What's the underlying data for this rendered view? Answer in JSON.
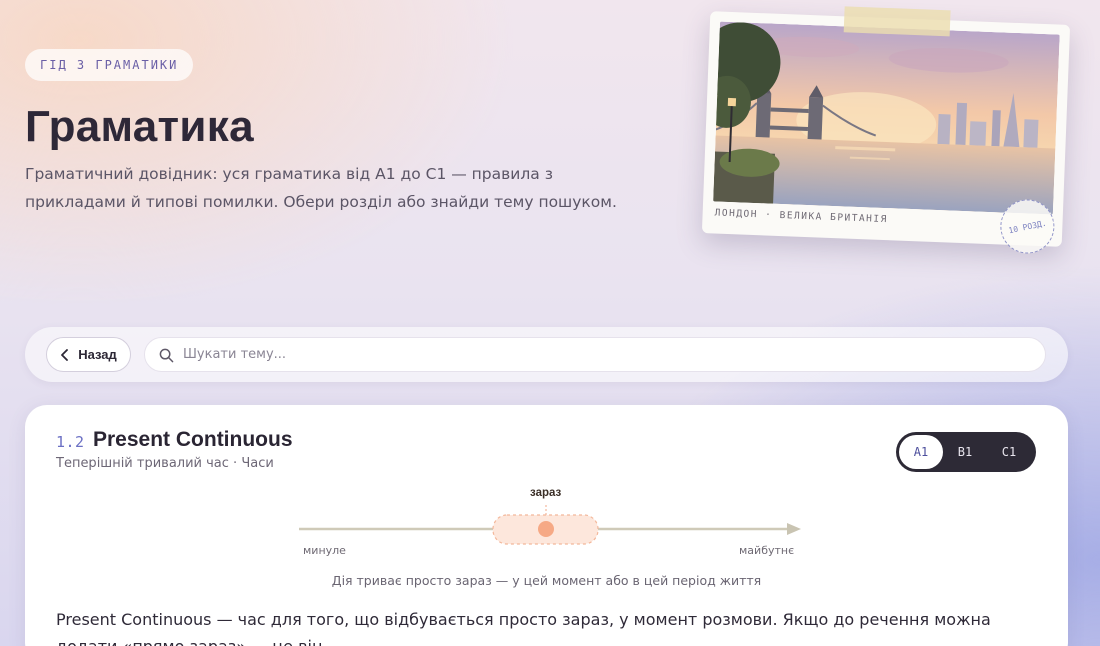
{
  "header": {
    "eyebrow": "ГІД З ГРАМАТИКИ",
    "title": "Граматика",
    "subtitle": "Граматичний довідник: уся граматика від A1 до C1 — правила з прикладами й типові помилки. Обери розділ або знайди тему пошуком."
  },
  "postcard": {
    "caption": "ЛОНДОН · ВЕЛИКА БРИТАНІЯ",
    "stamp": "10 РОЗД."
  },
  "toolbar": {
    "back_label": "Назад",
    "search_placeholder": "Шукати тему...",
    "search_value": ""
  },
  "topic": {
    "number": "1.2",
    "title": "Present Continuous",
    "subtitle": "Теперішній тривалий час · Часи",
    "levels": [
      {
        "label": "A1",
        "active": true
      },
      {
        "label": "B1",
        "active": false
      },
      {
        "label": "C1",
        "active": false
      }
    ],
    "timeline": {
      "now_label": "зараз",
      "past_label": "минуле",
      "future_label": "майбутнє",
      "caption": "Дія триває просто зараз — у цей момент або в цей період життя"
    },
    "body": "Present Continuous — час для того, що відбувається просто зараз, у момент розмови. Якщо до речення можна додати «прямо зараз» — це він."
  },
  "colors": {
    "accent": "#6b70c4",
    "timeline_highlight": "#f6a985",
    "level_pill_bg": "#2d2a36"
  }
}
